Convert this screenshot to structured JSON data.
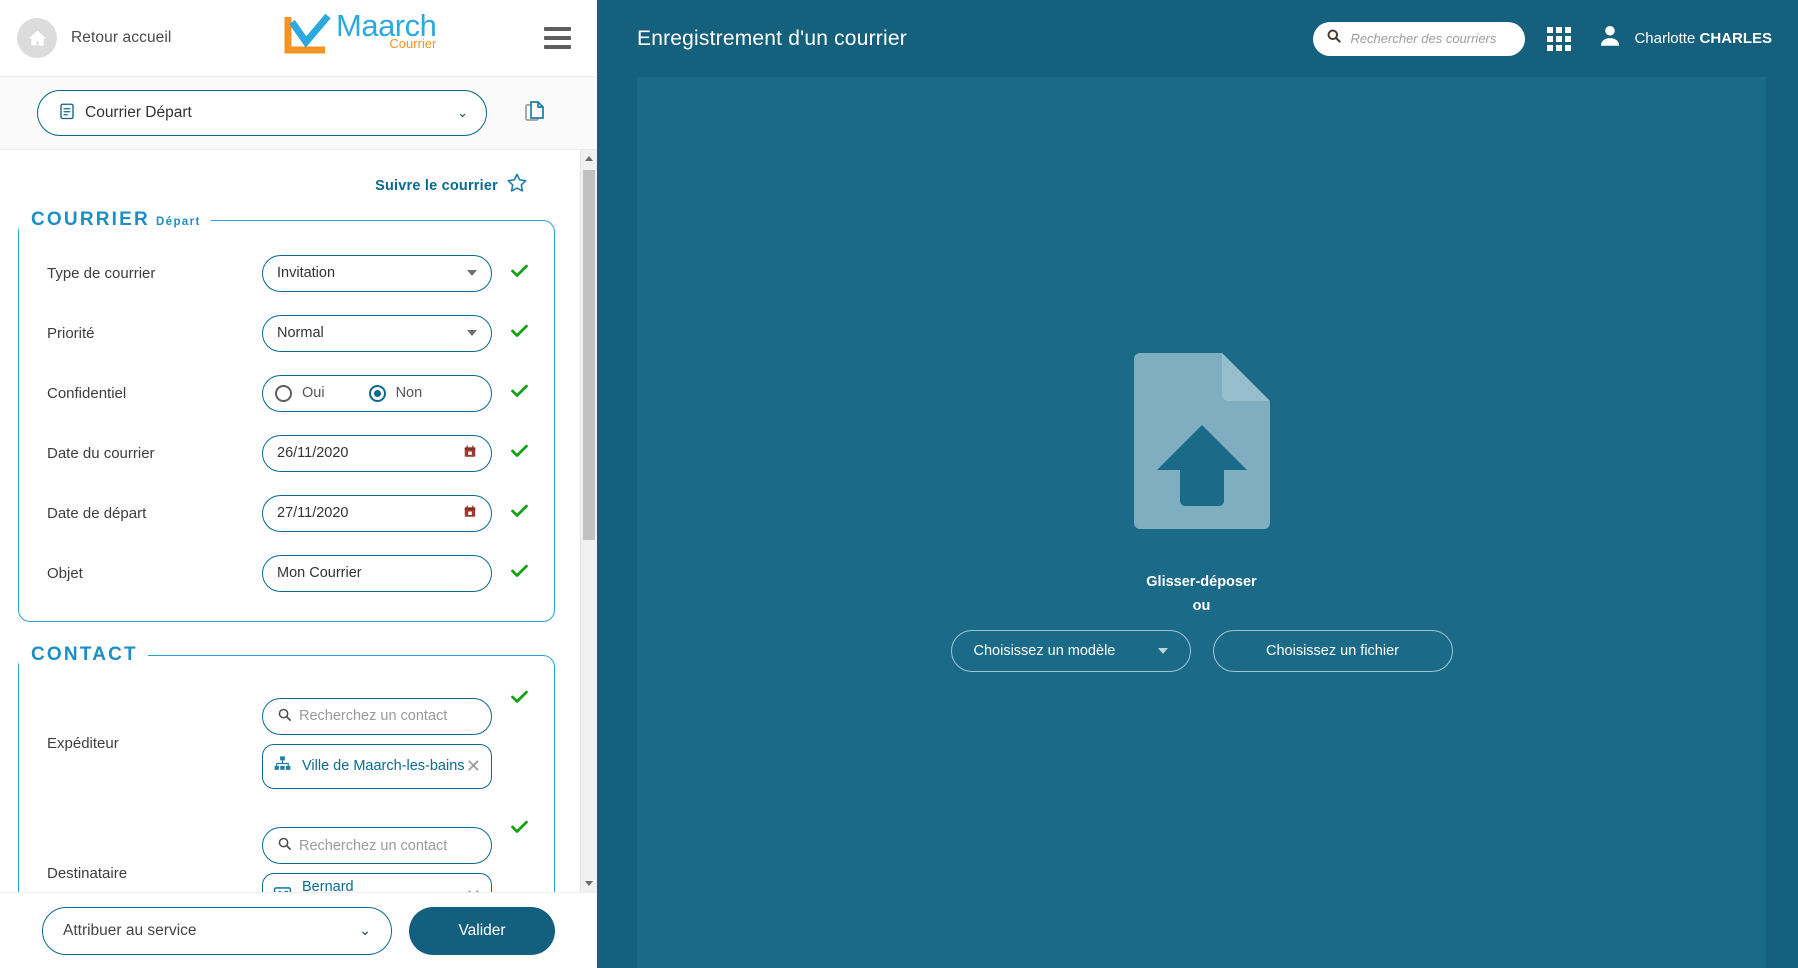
{
  "top_bar": {
    "home_label": "Retour accueil",
    "home_icon": "home-icon",
    "logo_main": "Maarch",
    "logo_sub": "Courrier",
    "menu_icon": "hamburger-menu-icon"
  },
  "type_row": {
    "selected": "Courrier Départ",
    "list_icon": "clipboard-list-icon",
    "chevron": "⌄",
    "copy_icon": "copy-documents-icon"
  },
  "follow": {
    "label": "Suivre le courrier",
    "star_icon": "star-outline-icon"
  },
  "sections": {
    "courrier": {
      "legend": "COURRIER",
      "legend_sub": "Départ",
      "fields": [
        {
          "label": "Type de courrier",
          "type": "select",
          "value": "Invitation",
          "valid": true
        },
        {
          "label": "Priorité",
          "type": "select",
          "value": "Normal",
          "valid": true
        },
        {
          "label": "Confidentiel",
          "type": "radio",
          "options": [
            "Oui",
            "Non"
          ],
          "selected": "Non",
          "valid": true
        },
        {
          "label": "Date du courrier",
          "type": "date",
          "value": "26/11/2020",
          "icon": "calendar-icon",
          "valid": true
        },
        {
          "label": "Date de départ",
          "type": "date",
          "value": "27/11/2020",
          "icon": "calendar-icon",
          "valid": true
        },
        {
          "label": "Objet",
          "type": "text",
          "value": "Mon Courrier",
          "valid": true
        }
      ]
    },
    "contact": {
      "legend": "CONTACT",
      "expediteur": {
        "label": "Expéditeur",
        "search_placeholder": "Recherchez un contact",
        "search_icon": "search-icon",
        "valid": true,
        "chip": {
          "text": "Ville de Maarch-les-bains",
          "icon": "organization-icon",
          "close_icon": "close-icon"
        }
      },
      "destinataire": {
        "label": "Destinataire",
        "search_placeholder": "Recherchez un contact",
        "search_icon": "search-icon",
        "valid": true,
        "chip": {
          "text": "Bernard PASCONTENT",
          "icon": "contact-card-icon",
          "status_dot_color": "#12b712",
          "close_icon": "close-icon"
        }
      }
    }
  },
  "bottom_bar": {
    "service_label": "Attribuer au service",
    "service_chevron": "⌄",
    "validate_label": "Valider"
  },
  "right_header": {
    "page_title": "Enregistrement d'un courrier",
    "search_placeholder": "Rechercher des courriers",
    "search_icon": "search-icon",
    "apps_icon": "apps-grid-icon",
    "avatar_icon": "user-avatar-icon",
    "user_first_name": "Charlotte",
    "user_last_name": "CHARLES"
  },
  "drop_zone": {
    "upload_icon": "file-upload-icon",
    "title": "Glisser-déposer",
    "or": "ou",
    "model_button": "Choisissez un modèle",
    "file_button": "Choisissez un fichier"
  },
  "colors": {
    "brand_blue": "#14607D",
    "panel_blue": "#1A6A88",
    "accent_cyan": "#2AA3D6",
    "logo_blue": "#2EA9E0",
    "logo_orange": "#F39324",
    "valid_green": "#12b712",
    "calendar_red": "#9e3a34"
  }
}
